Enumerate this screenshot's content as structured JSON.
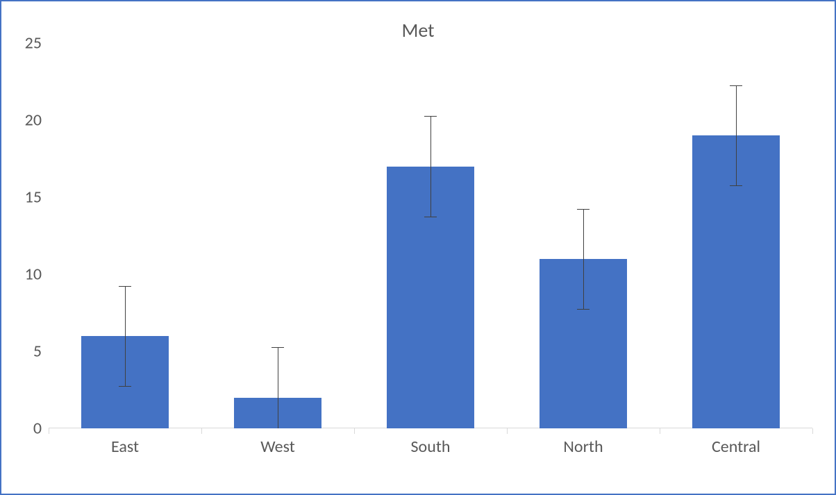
{
  "chart_data": {
    "type": "bar",
    "title": "Met",
    "categories": [
      "East",
      "West",
      "South",
      "North",
      "Central"
    ],
    "values": [
      6,
      2,
      17,
      11,
      19
    ],
    "error": [
      3.25,
      3.25,
      3.25,
      3.25,
      3.25
    ],
    "xlabel": "",
    "ylabel": "",
    "ylim": [
      0,
      25
    ],
    "yticks": [
      0,
      5,
      10,
      15,
      20,
      25
    ],
    "colors": {
      "bar": "#4472c4",
      "border": "#4472c4",
      "text": "#595959",
      "error": "#404040"
    }
  }
}
